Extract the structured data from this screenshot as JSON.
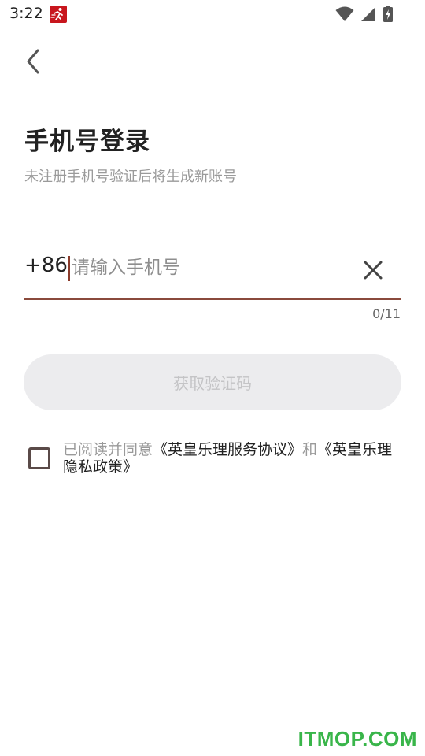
{
  "status_bar": {
    "time": "3:22",
    "notification_icon": "running-person-icon",
    "icons": [
      "wifi-icon",
      "cellular-signal-icon",
      "battery-charging-icon"
    ],
    "notification_color": "#c8161d"
  },
  "nav": {
    "back_icon": "chevron-left-icon"
  },
  "header": {
    "title": "手机号登录",
    "subtitle": "未注册手机号验证后将生成新账号"
  },
  "phone": {
    "country_code": "+86",
    "placeholder": "请输入手机号",
    "value": "",
    "clear_icon": "close-icon",
    "counter": "0/11",
    "accent_color": "#8a4a3c"
  },
  "code_button": {
    "label": "获取验证码"
  },
  "agreement": {
    "checked": false,
    "prefix": "已阅读并同意",
    "service_link": "《英皇乐理服务协议》",
    "and": "和",
    "privacy_link": "《英皇乐理隐私政策》"
  },
  "watermark": "ITMOP.COM"
}
